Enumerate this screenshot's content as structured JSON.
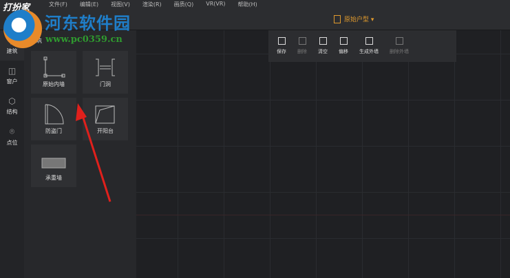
{
  "app": {
    "logo": "打扮家"
  },
  "menu": [
    "文件(F)",
    "编辑(E)",
    "视图(V)",
    "渲染(R)",
    "画质(Q)",
    "VR(VR)",
    "帮助(H)"
  ],
  "watermark": {
    "title": "河东软件园",
    "url": "www.pc0359.cn"
  },
  "plan_selector": {
    "label": "原始户型 ▾",
    "color": "#e09a2e"
  },
  "nav": [
    {
      "label": "建筑",
      "icon": "wall-icon"
    },
    {
      "label": "窗户",
      "icon": "window-icon"
    },
    {
      "label": "结构",
      "icon": "cube-icon"
    },
    {
      "label": "点位",
      "icon": "pin-icon"
    }
  ],
  "panel": {
    "title": "建筑",
    "items": [
      "原始内墙",
      "门洞",
      "防盗门",
      "开阳台",
      "承重墙"
    ]
  },
  "toolbar": [
    {
      "label": "保存",
      "enabled": true
    },
    {
      "label": "删除",
      "enabled": false
    },
    {
      "label": "清空",
      "enabled": true
    },
    {
      "label": "偏移",
      "enabled": true
    },
    {
      "label": "生成外墙",
      "enabled": true
    },
    {
      "label": "删除外墙",
      "enabled": false
    }
  ]
}
